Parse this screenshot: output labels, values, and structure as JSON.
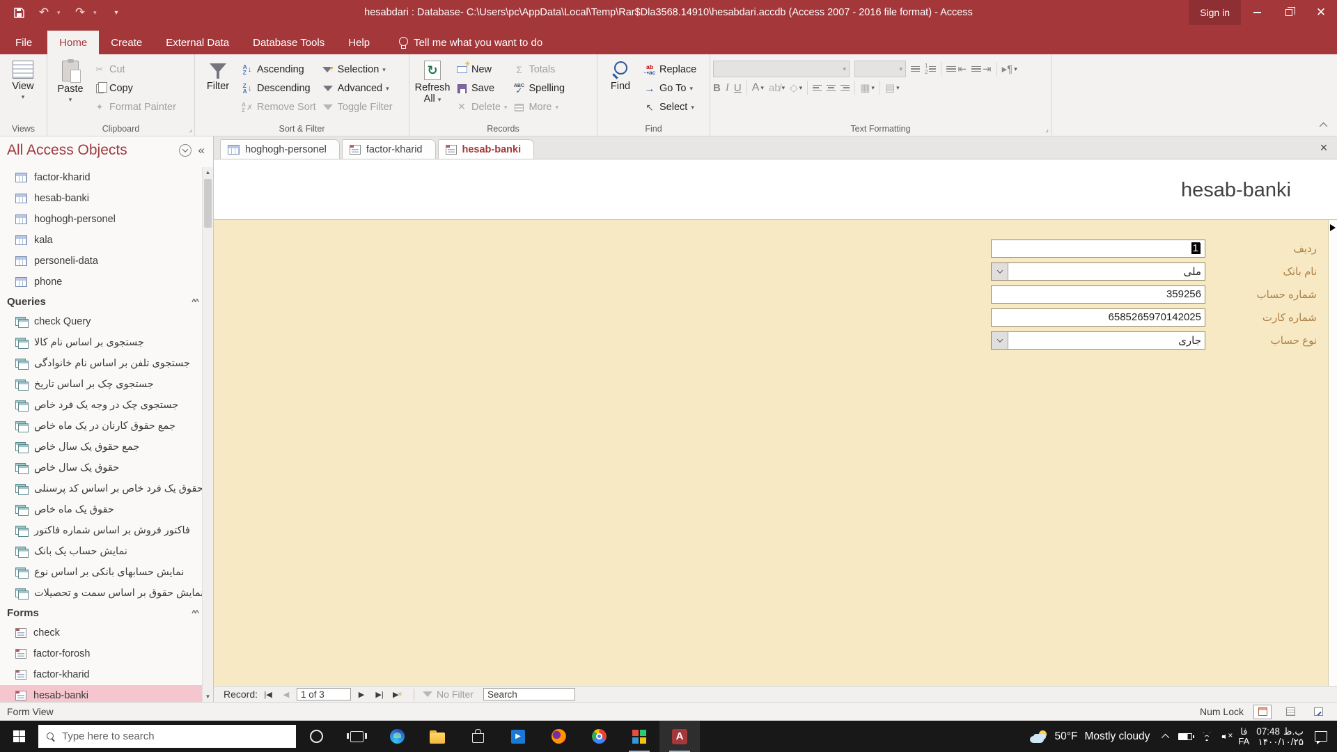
{
  "colors": {
    "accent": "#a4373a",
    "form_body": "#f7e9c4",
    "nav_selected": "#f5c6ce"
  },
  "window": {
    "title": "hesabdari : Database- C:\\Users\\pc\\AppData\\Local\\Temp\\Rar$Dla3568.14910\\hesabdari.accdb (Access 2007 - 2016 file format)  -  Access",
    "sign_in": "Sign in"
  },
  "ribbon": {
    "tabs": [
      "File",
      "Home",
      "Create",
      "External Data",
      "Database Tools",
      "Help"
    ],
    "tell_me": "Tell me what you want to do",
    "views": {
      "view": "View",
      "caption": "Views"
    },
    "clipboard": {
      "paste": "Paste",
      "cut": "Cut",
      "copy": "Copy",
      "format_painter": "Format Painter",
      "caption": "Clipboard"
    },
    "sort_filter": {
      "filter": "Filter",
      "ascending": "Ascending",
      "descending": "Descending",
      "remove_sort": "Remove Sort",
      "selection": "Selection",
      "advanced": "Advanced",
      "toggle_filter": "Toggle Filter",
      "caption": "Sort & Filter"
    },
    "records": {
      "refresh_line1": "Refresh",
      "refresh_line2": "All",
      "new": "New",
      "save": "Save",
      "delete": "Delete",
      "totals": "Totals",
      "spelling": "Spelling",
      "more": "More",
      "caption": "Records"
    },
    "find": {
      "find": "Find",
      "replace": "Replace",
      "go_to": "Go To",
      "select": "Select",
      "caption": "Find"
    },
    "text_formatting": {
      "caption": "Text Formatting",
      "bold": "B",
      "italic": "I",
      "underline": "U"
    }
  },
  "navpane": {
    "title": "All Access Objects",
    "tables": [
      "factor-kharid",
      "hesab-banki",
      "hoghogh-personel",
      "kala",
      "personeli-data",
      "phone"
    ],
    "queries_header": "Queries",
    "queries": [
      "check Query",
      "جستجوی بر اساس نام کالا",
      "جستجوی تلفن بر اساس نام خانوادگی",
      "جستجوی چک بر اساس تاریخ",
      "جستجوی چک در وجه یک فرد خاص",
      "جمع حقوق کارنان در یک ماه خاص",
      "جمع حقوق یک سال خاص",
      "حقوق یک سال خاص",
      "حقوق یک فرد خاص بر اساس کد پرسنلی",
      "حقوق یک ماه خاص",
      "فاکتور فروش بر اساس شماره فاکتور",
      "نمایش حساب یک بانک",
      "نمایش حسابهای بانکی بر اساس نوع",
      "نمایش حقوق بر اساس سمت و تحصیلات"
    ],
    "forms_header": "Forms",
    "forms": [
      "check",
      "factor-forosh",
      "factor-kharid",
      "hesab-banki"
    ]
  },
  "doc_tabs": [
    "hoghogh-personel",
    "factor-kharid",
    "hesab-banki"
  ],
  "form": {
    "title": "hesab-banki",
    "fields": [
      {
        "label": "ردیف",
        "value": "1"
      },
      {
        "label": "نام بانک",
        "value": "ملی"
      },
      {
        "label": "شماره حساب",
        "value": "359256"
      },
      {
        "label": "شماره کارت",
        "value": "6585265970142025"
      },
      {
        "label": "نوع حساب",
        "value": "جاری"
      }
    ]
  },
  "record_nav": {
    "label": "Record:",
    "position": "1 of 3",
    "no_filter": "No Filter",
    "search": "Search"
  },
  "status_bar": {
    "left": "Form View",
    "num_lock": "Num Lock"
  },
  "taskbar": {
    "search_placeholder": "Type here to search",
    "weather_temp": "50°F",
    "weather_desc": "Mostly cloudy",
    "lang_top": "فا",
    "lang_bottom": "FA",
    "time": "07:48",
    "ampm": "ب.ظ",
    "date": "۱۴۰۰/۱۰/۲۵"
  }
}
